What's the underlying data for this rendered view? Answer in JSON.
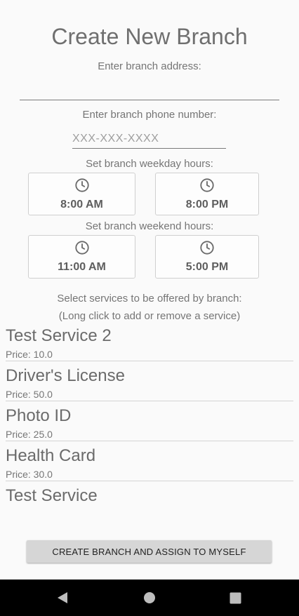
{
  "header": {
    "title": "Create New Branch"
  },
  "address": {
    "label": "Enter branch address:",
    "value": "",
    "placeholder": ""
  },
  "phone": {
    "label": "Enter branch phone number:",
    "value": "",
    "placeholder": "XXX-XXX-XXXX"
  },
  "weekday": {
    "label": "Set branch weekday hours:",
    "open": "8:00 AM",
    "close": "8:00 PM"
  },
  "weekend": {
    "label": "Set branch weekend hours:",
    "open": "11:00 AM",
    "close": "5:00 PM"
  },
  "services": {
    "label": "Select services to be offered by branch:",
    "hint": "(Long click to add or remove a service)",
    "items": [
      {
        "name": "Test Service 2",
        "price": "Price: 10.0"
      },
      {
        "name": "Driver's License",
        "price": "Price: 50.0"
      },
      {
        "name": "Photo ID",
        "price": "Price: 25.0"
      },
      {
        "name": "Health Card",
        "price": "Price: 30.0"
      },
      {
        "name": "Test Service",
        "price": ""
      }
    ]
  },
  "actions": {
    "create_label": "CREATE BRANCH AND ASSIGN TO MYSELF"
  },
  "icons": {
    "clock": "clock-icon",
    "back": "back-icon",
    "home": "home-icon",
    "recents": "recents-icon"
  }
}
